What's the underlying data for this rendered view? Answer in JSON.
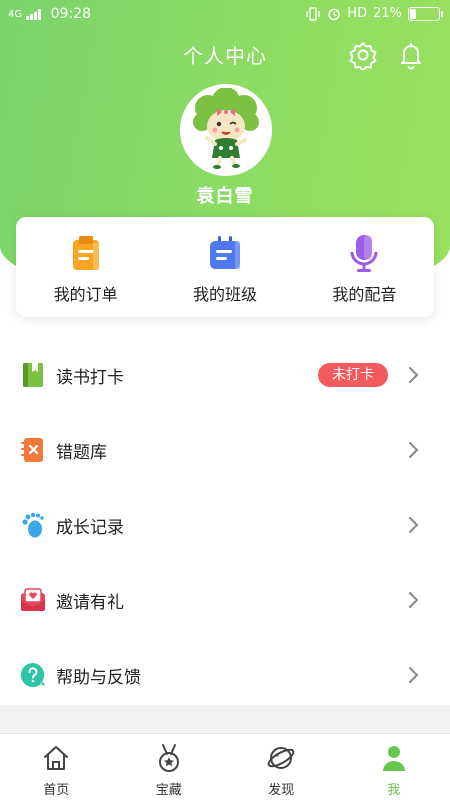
{
  "status_bar": {
    "network": "4G",
    "time": "09:28",
    "hd_label": "HD",
    "battery_text": "21%",
    "battery_level": 0.21
  },
  "header": {
    "title": "个人中心",
    "icons": [
      "gear-icon",
      "bell-icon"
    ]
  },
  "profile": {
    "name": "袁白雪",
    "avatar": "cartoon-broccoli-avatar"
  },
  "quick_actions": [
    {
      "label": "我的订单",
      "icon": "order-clipboard-icon",
      "color": "#f6a623"
    },
    {
      "label": "我的班级",
      "icon": "class-icon",
      "color": "#4f79f2"
    },
    {
      "label": "我的配音",
      "icon": "microphone-icon",
      "color": "#9b5de5"
    }
  ],
  "menu": [
    {
      "label": "读书打卡",
      "icon": "book-icon",
      "badge": "未打卡"
    },
    {
      "label": "错题库",
      "icon": "mistake-notebook-icon"
    },
    {
      "label": "成长记录",
      "icon": "footprint-icon"
    },
    {
      "label": "邀请有礼",
      "icon": "envelope-heart-icon"
    },
    {
      "label": "帮助与反馈",
      "icon": "help-icon"
    }
  ],
  "tabs": [
    {
      "label": "首页",
      "icon": "home-icon"
    },
    {
      "label": "宝藏",
      "icon": "medal-icon"
    },
    {
      "label": "发现",
      "icon": "planet-icon"
    },
    {
      "label": "我",
      "icon": "user-icon",
      "active": true
    }
  ],
  "colors": {
    "accent_green": "#7ad56b",
    "active_tab": "#69c64d",
    "badge_red": "#f25a5e"
  }
}
